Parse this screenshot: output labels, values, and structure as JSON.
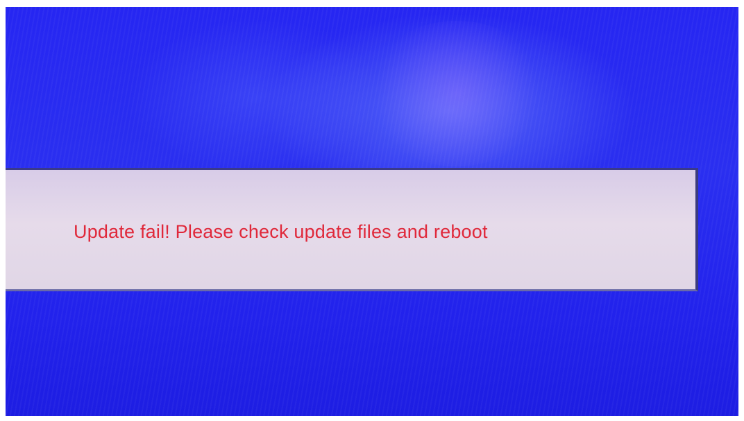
{
  "dialog": {
    "message": "Update fail! Please check update files and reboot",
    "text_color": "#e0283a",
    "bar_color": "#e2d8e8"
  },
  "screen": {
    "background_color": "#2626f2"
  }
}
